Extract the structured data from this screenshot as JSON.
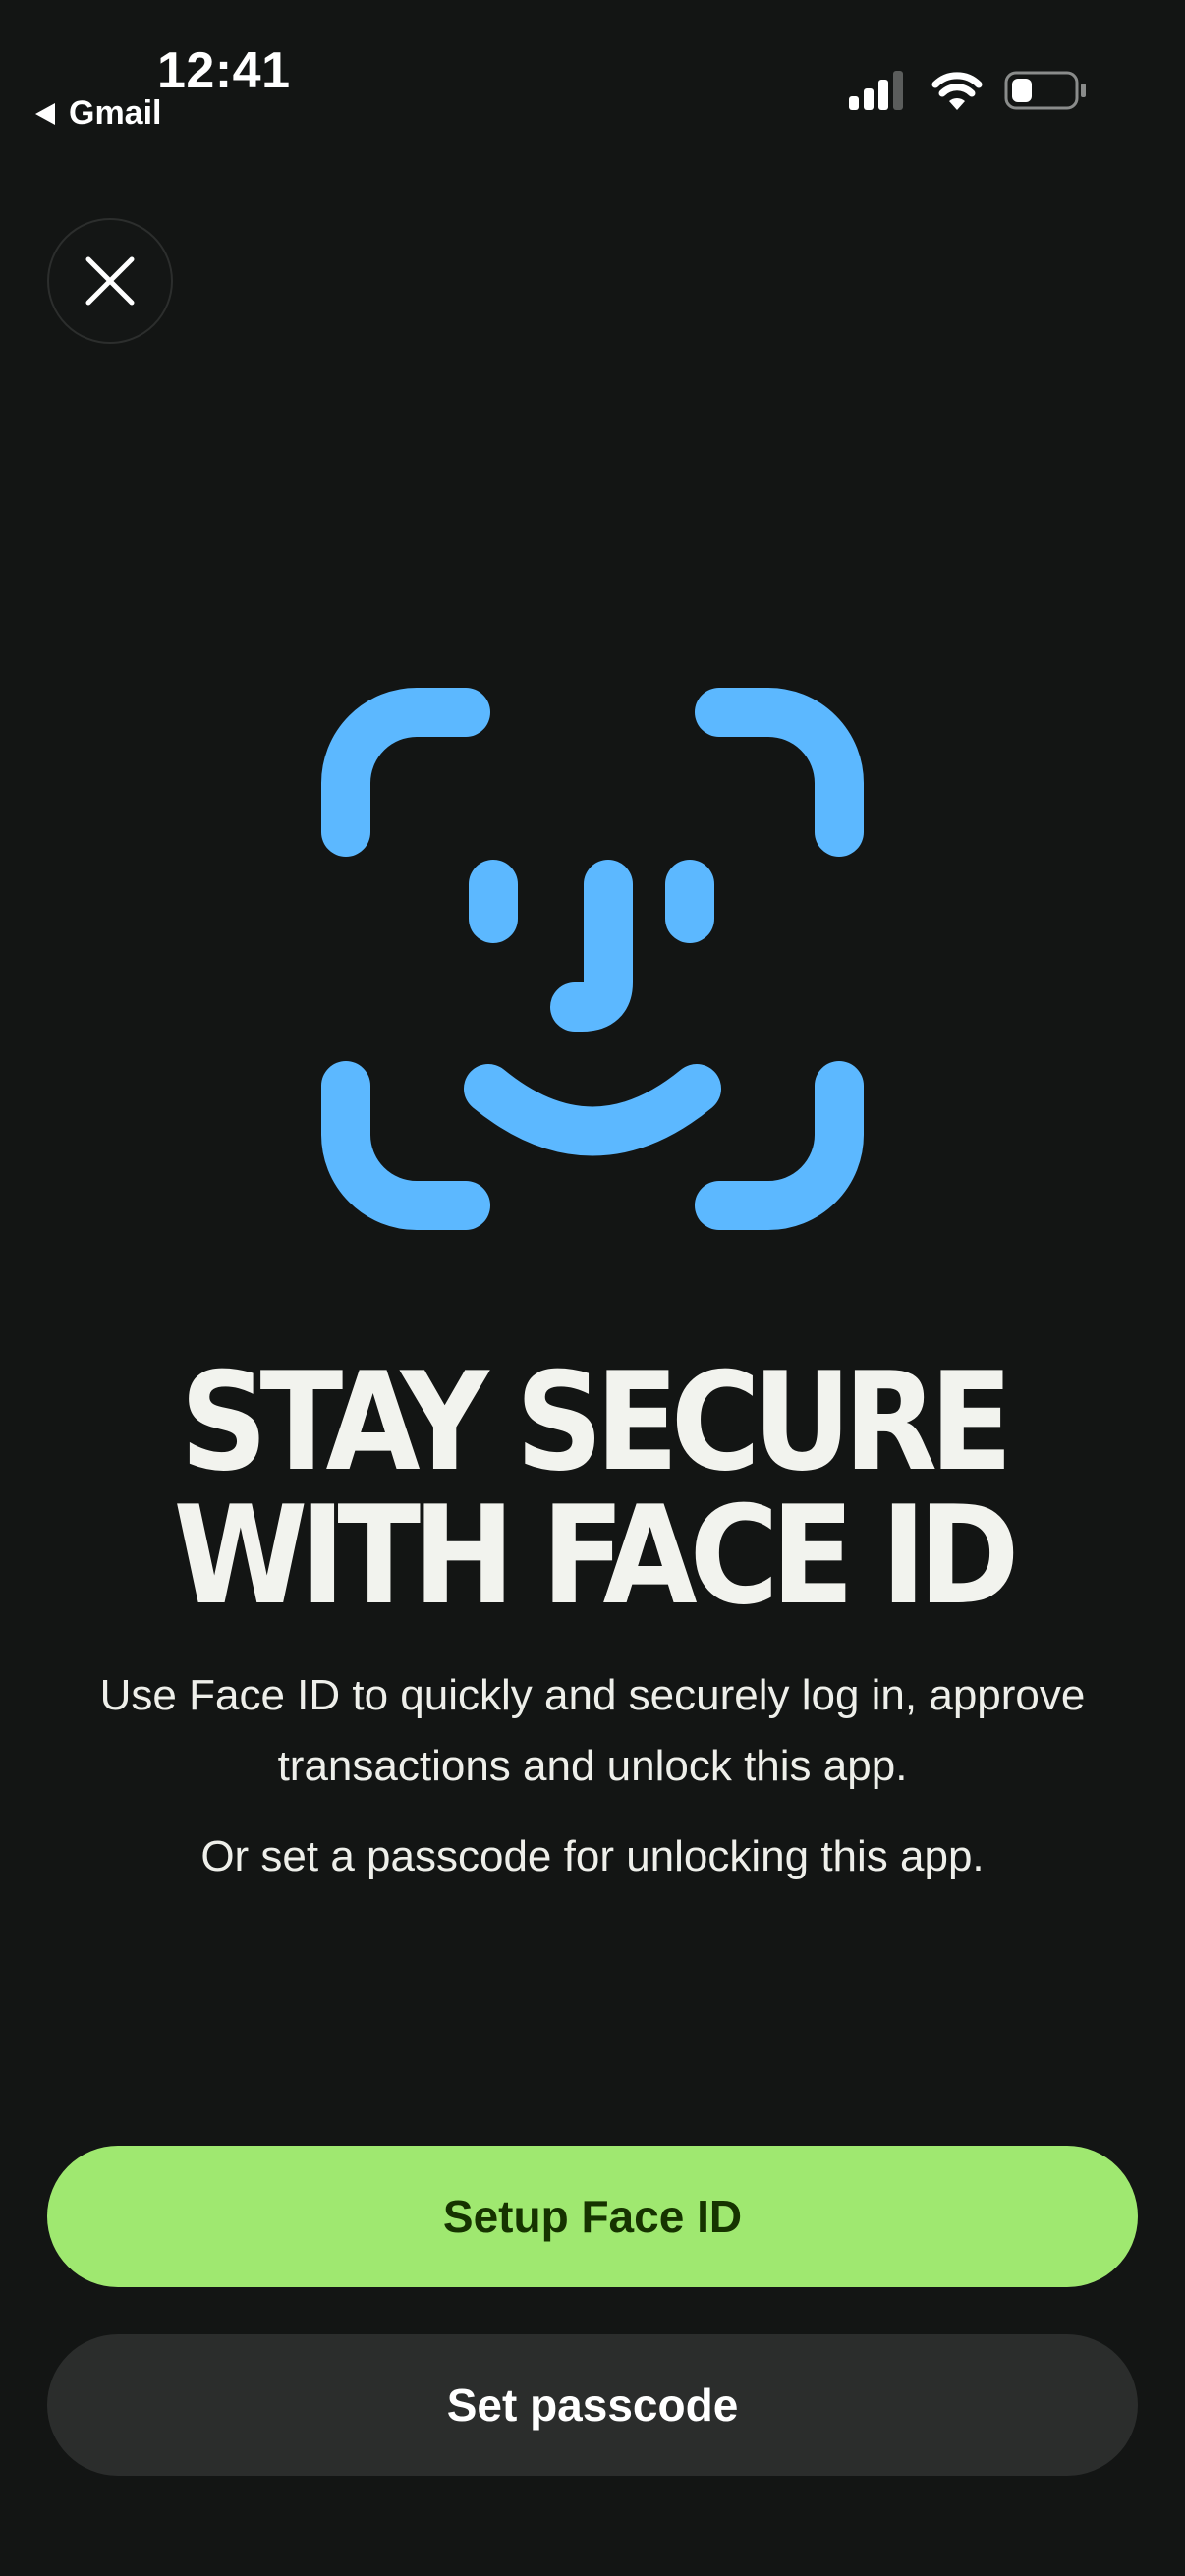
{
  "status_bar": {
    "time": "12:41",
    "back_app": "Gmail",
    "icons": [
      "cellular-signal-icon",
      "wifi-icon",
      "battery-icon"
    ]
  },
  "close_button": {
    "icon": "close-icon"
  },
  "illustration": {
    "icon": "face-id-icon",
    "color": "#5cb8ff"
  },
  "content": {
    "title_line1": "STAY SECURE",
    "title_line2": "WITH FACE ID",
    "description": "Use Face ID to quickly and securely log in, approve transactions and unlock this app.",
    "secondary_description": "Or set a passcode for unlocking this app."
  },
  "actions": {
    "primary_label": "Setup Face ID",
    "secondary_label": "Set passcode"
  },
  "colors": {
    "background": "#131514",
    "primary_button": "#9fe870",
    "primary_button_text": "#163300",
    "secondary_button": "#2b2d2c",
    "accent": "#5cb8ff"
  }
}
